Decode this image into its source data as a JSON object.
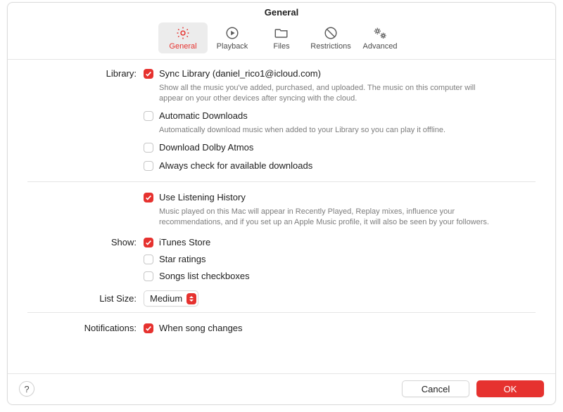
{
  "title": "General",
  "tabs": {
    "general": {
      "label": "General"
    },
    "playback": {
      "label": "Playback"
    },
    "files": {
      "label": "Files"
    },
    "restrictions": {
      "label": "Restrictions"
    },
    "advanced": {
      "label": "Advanced"
    }
  },
  "sections": {
    "library": {
      "label": "Library:",
      "sync_library": {
        "checked": true,
        "label": "Sync Library (daniel_rico1@icloud.com)",
        "desc": "Show all the music you've added, purchased, and uploaded. The music on this computer will appear on your other devices after syncing with the cloud."
      },
      "auto_downloads": {
        "checked": false,
        "label": "Automatic Downloads",
        "desc": "Automatically download music when added to your Library so you can play it offline."
      },
      "dolby": {
        "checked": false,
        "label": "Download Dolby Atmos"
      },
      "check_available": {
        "checked": false,
        "label": "Always check for available downloads"
      }
    },
    "history": {
      "use_history": {
        "checked": true,
        "label": "Use Listening History",
        "desc": "Music played on this Mac will appear in Recently Played, Replay mixes, influence your recommendations, and if you set up an Apple Music profile, it will also be seen by your followers."
      }
    },
    "show": {
      "label": "Show:",
      "itunes_store": {
        "checked": true,
        "label": "iTunes Store"
      },
      "star_ratings": {
        "checked": false,
        "label": "Star ratings"
      },
      "songs_checkboxes": {
        "checked": false,
        "label": "Songs list checkboxes"
      }
    },
    "list_size": {
      "label": "List Size:",
      "value": "Medium"
    },
    "notifications": {
      "label": "Notifications:",
      "song_changes": {
        "checked": true,
        "label": "When song changes"
      }
    }
  },
  "footer": {
    "cancel": "Cancel",
    "ok": "OK"
  },
  "colors": {
    "accent": "#e6322f"
  }
}
